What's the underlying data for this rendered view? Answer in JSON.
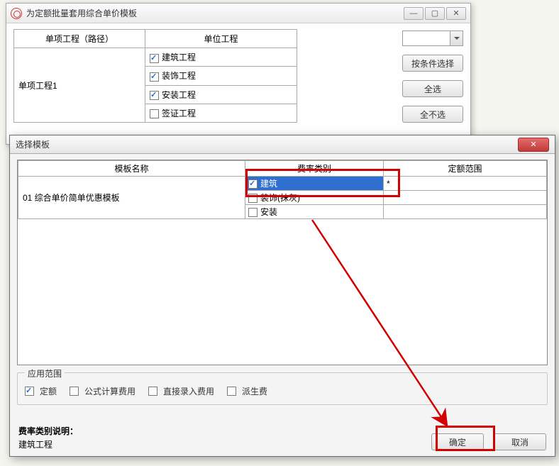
{
  "win1": {
    "title": "为定额批量套用综合单价模板",
    "col1": "单项工程（路径）",
    "col2": "单位工程",
    "proj": "单项工程1",
    "rows": [
      {
        "label": "建筑工程",
        "on": true
      },
      {
        "label": "装饰工程",
        "on": true
      },
      {
        "label": "安装工程",
        "on": true
      },
      {
        "label": "签证工程",
        "on": false
      }
    ],
    "btn_filter": "按条件选择",
    "btn_all": "全选",
    "btn_none": "全不选"
  },
  "modal": {
    "title": "选择模板",
    "cols": [
      "模板名称",
      "费率类别",
      "定额范围"
    ],
    "tplname": "01 综合单价简单优惠模板",
    "rows": [
      {
        "label": "建筑",
        "on": true,
        "sel": true,
        "range": "*"
      },
      {
        "label": "装饰(抹灰)",
        "on": false,
        "sel": false,
        "range": ""
      },
      {
        "label": "安装",
        "on": false,
        "sel": false,
        "range": ""
      }
    ],
    "scope_title": "应用范围",
    "scope": [
      {
        "label": "定额",
        "on": true
      },
      {
        "label": "公式计算费用",
        "on": false
      },
      {
        "label": "直接录入费用",
        "on": false
      },
      {
        "label": "派生费",
        "on": false
      }
    ],
    "desc_h": "费率类别说明：",
    "desc_t": "建筑工程",
    "ok": "确定",
    "cancel": "取消"
  }
}
